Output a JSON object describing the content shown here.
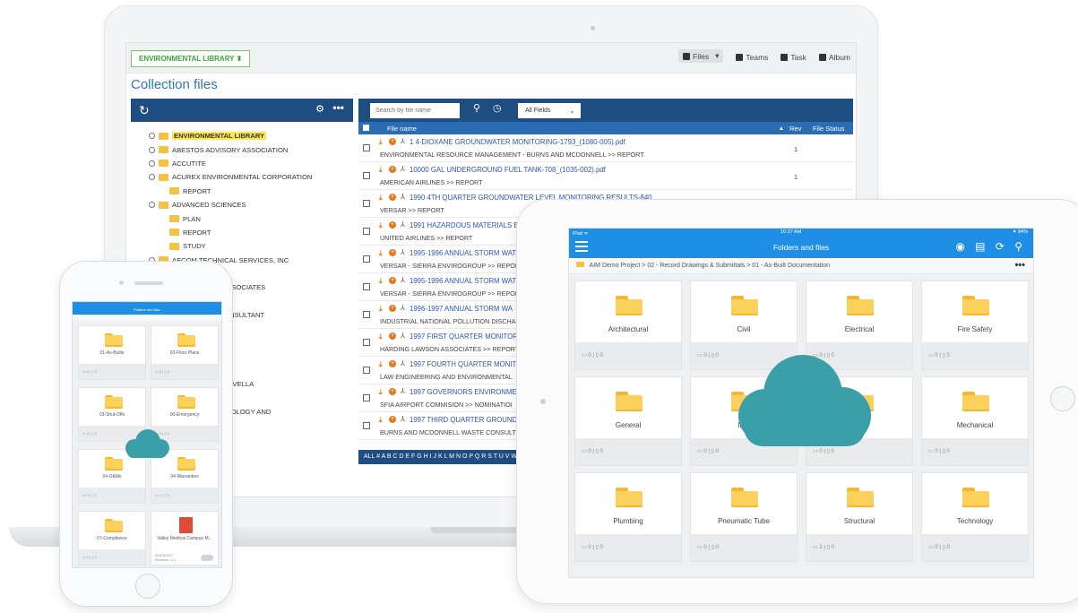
{
  "laptop": {
    "library_select": "ENVIRONMENTAL LIBRARY ⬍",
    "tabs": [
      {
        "label": "Files"
      },
      {
        "label": "Teams"
      },
      {
        "label": "Task"
      },
      {
        "label": "Album"
      }
    ],
    "files_caret": "▾",
    "page_title": "Collection files",
    "tree": [
      {
        "label": "ENVIRONMENTAL LIBRARY",
        "root": true
      },
      {
        "label": "ABESTOS ADVISORY ASSOCIATION"
      },
      {
        "label": "ACCUTITE"
      },
      {
        "label": "ACUREX ENVIRONMENTAL CORPORATION"
      },
      {
        "label": "REPORT"
      },
      {
        "label": "ADVANCED SCIENCES"
      },
      {
        "label": "PLAN"
      },
      {
        "label": "REPORT"
      },
      {
        "label": "STUDY"
      },
      {
        "label": "AECOM TECHNICAL SERVICES, INC"
      },
      {
        "label": ""
      },
      {
        "label": "IATION WITH WAHLER ASSOCIATES"
      },
      {
        "label": "OUP"
      },
      {
        "label": "MENT ENGINEERING CONSULTANT"
      },
      {
        "label": "ON"
      },
      {
        "label": "NTAL OVERSIGHT TEAM"
      },
      {
        "label": "ION"
      },
      {
        "label": ""
      },
      {
        "label": "AEL VARNER MAURICIO AVELLA"
      },
      {
        "label": "ENTAL SOLUTIONS"
      },
      {
        "label": "MS CONSULTANTS IN GEOLOGY AND"
      },
      {
        "label": "OGY AND SCIENCE"
      },
      {
        "label": "NOLOGIES"
      },
      {
        "label": "IAN AND ASSOCIATES"
      },
      {
        "label": "SSOCIATES"
      }
    ],
    "search_placeholder": "Search by file name",
    "fields_select": "All Fields",
    "columns": {
      "file_name": "File name",
      "rev": "Rev",
      "file_status": "File Status"
    },
    "files": [
      {
        "name": "1 4-DIOXANE GROUNDWATER MONITORING-1793_(1080-005).pdf",
        "path": "ENVIRONMENTAL RESOURCE MANAGEMENT - BURNS AND MCDONNELL >> REPORT",
        "rev": "1"
      },
      {
        "name": "10000 GAL UNDERGROUND FUEL TANK-708_(1035-002).pdf",
        "path": "AMERICAN AIRLINES >> REPORT",
        "rev": "1"
      },
      {
        "name": "1990 4TH QUARTER GROUNDWATER LEVEL MONITORING RESULTS-840",
        "path": "VERSAR >> REPORT",
        "rev": ""
      },
      {
        "name": "1991 HAZARDOUS MATERIALS B",
        "path": "UNITED AIRLINES >> REPORT",
        "rev": ""
      },
      {
        "name": "1995-1996 ANNUAL STORM WAT",
        "path": "VERSAR - SIERRA ENVIROGROUP >> REPORT",
        "rev": ""
      },
      {
        "name": "1995-1996 ANNUAL STORM WAT",
        "path": "VERSAR - SIERRA ENVIROGROUP >> REPORT",
        "rev": ""
      },
      {
        "name": "1996-1997 ANNUAL STORM WA",
        "path": "INDUSTRIAL NATIONAL POLLUTION DISCHA",
        "rev": ""
      },
      {
        "name": "1997 FIRST QUARTER MONITOR",
        "path": "HARDING LAWSON ASSOCIATES >> REPORT",
        "rev": ""
      },
      {
        "name": "1997 FOURTH QUARTER MONITO",
        "path": "LAW ENGINEERING AND ENVIRONMENTAL",
        "rev": ""
      },
      {
        "name": "1997 GOVERNORS ENVIRONMEN",
        "path": "SFIA AIRPORT COMMISION >> NOMINATIOI",
        "rev": ""
      },
      {
        "name": "1997 THIRD QUARTER GROUND",
        "path": "BURNS AND MCDONNELL WASTE CONSULT",
        "rev": ""
      }
    ],
    "alphabet_bar": "ALL # A B C D E F G H I J K L M N O P Q R S T U V W X"
  },
  "tablet": {
    "status_left": "iPad ᯤ",
    "status_time": "10:37 AM",
    "status_right": "⁕ 84%",
    "title": "Folders and files",
    "header_icons": "◉ ▤ ⟳ ⚲",
    "breadcrumb": "AIM Demo Project > 02 - Record Drawings & Submittals > 01 - As-Built Documentation",
    "more": "•••",
    "folders": [
      {
        "label": "Architectural",
        "meta": "▭ 0 | ▯ 0"
      },
      {
        "label": "Civil",
        "meta": "▭ 0 | ▯ 0"
      },
      {
        "label": "Electrical",
        "meta": "▭ 0 | ▯ 0"
      },
      {
        "label": "Fire Safety",
        "meta": "▭ 0 | ▯ 0"
      },
      {
        "label": "General",
        "meta": "▭ 0 | ▯ 0"
      },
      {
        "label": "Inte",
        "meta": "▭ 0 | ▯ 0"
      },
      {
        "label": "",
        "meta": "▭ 0 | ▯ 0"
      },
      {
        "label": "Mechanical",
        "meta": "▭ 0 | ▯ 0"
      },
      {
        "label": "Plumbing",
        "meta": "▭ 0 | ▯ 0"
      },
      {
        "label": "Pneumatic Tube",
        "meta": "▭ 0 | ▯ 0"
      },
      {
        "label": "Structural",
        "meta": "▭ 1 | ▯ 0"
      },
      {
        "label": "Technology",
        "meta": "▭ 0 | ▯ 0"
      }
    ]
  },
  "phone": {
    "title": "Folders and files",
    "folders": [
      {
        "label": "01-As-Builts",
        "meta": "▭ 0 | ▯ 0"
      },
      {
        "label": "02-Floor Plans",
        "meta": "▭ 0 | ▯ 0"
      },
      {
        "label": "03-Shut-Offs",
        "meta": "▭ 0 | ▯ 0"
      },
      {
        "label": "06-Emergency",
        "meta": "▭ 0 | ▯ 0"
      },
      {
        "label": "04-O&Ms",
        "meta": "▭ 0 | ▯ 0"
      },
      {
        "label": "04-Warranties",
        "meta": "▭ 0 | ▯ 0"
      },
      {
        "label": "07-Compliance",
        "meta": "▭ 0 | ▯ 0"
      }
    ],
    "pdf_file": {
      "label": "Valley Medical Campus M...",
      "date": "03/10/2017",
      "rev": "Revision: 0.1"
    }
  },
  "colors": {
    "brand_dark": "#1e4d82",
    "brand_blue": "#2b6cb3",
    "mobile_blue": "#1e8fe4",
    "cloud": "#3a9fa8",
    "folder": "#fbd15c",
    "accent_orange": "#e2791c",
    "library_green": "#3ca63b"
  }
}
